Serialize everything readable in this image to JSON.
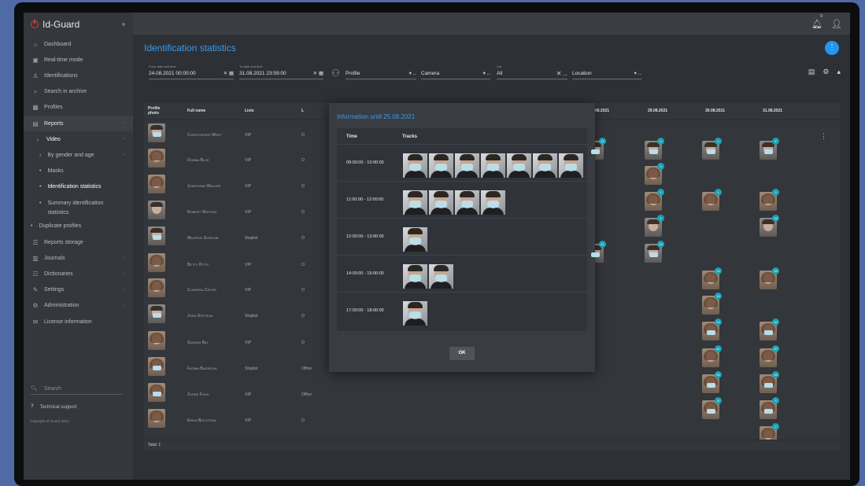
{
  "app": {
    "name": "Id-Guard"
  },
  "sidebar": {
    "items": [
      {
        "label": "Dashboard",
        "icon": "home-icon"
      },
      {
        "label": "Real-time mode",
        "icon": "realtime-icon"
      },
      {
        "label": "Identifications",
        "icon": "person-icon"
      },
      {
        "label": "Search in archive",
        "icon": "search-archive-icon"
      },
      {
        "label": "Profiles",
        "icon": "profiles-icon"
      },
      {
        "label": "Reports",
        "icon": "reports-icon"
      },
      {
        "label": "Video"
      },
      {
        "label": "By gender and age"
      },
      {
        "label": "Masks"
      },
      {
        "label": "Identification statistics"
      },
      {
        "label": "Summary identification statistics"
      },
      {
        "label": "Duplicate profiles"
      },
      {
        "label": "Reports storage",
        "icon": "storage-icon"
      },
      {
        "label": "Journals",
        "icon": "journals-icon"
      },
      {
        "label": "Dictionaries",
        "icon": "dictionaries-icon"
      },
      {
        "label": "Settings",
        "icon": "wrench-icon"
      },
      {
        "label": "Administration",
        "icon": "gear-icon"
      },
      {
        "label": "License information",
        "icon": "license-icon"
      }
    ],
    "search_placeholder": "Search",
    "support": "Technical support",
    "copyright": "Copyright Id-Guard 2021"
  },
  "topbar": {
    "notification_count": "0"
  },
  "page": {
    "title": "Identification statistics"
  },
  "filters": {
    "from": {
      "label": "From date and time",
      "value": "24.08.2021 00:00:00"
    },
    "to": {
      "label": "To date and time",
      "value": "31.08.2021 23:59:00"
    },
    "profile": "Profile",
    "camera": "Camera",
    "list": {
      "label": "List",
      "value": "All"
    },
    "location": "Location"
  },
  "table": {
    "columns": [
      "Profile photo",
      "Full name",
      "Lists",
      "L",
      "28.08.2021",
      "29.08.2021",
      "30.08.2021",
      "31.08.2021"
    ],
    "rows": [
      {
        "name": "Christopher West",
        "list": "VIP",
        "loc": "O"
      },
      {
        "name": "Donna Blue",
        "list": "VIP",
        "loc": "O"
      },
      {
        "name": "Josephine Walker",
        "list": "VIP",
        "loc": "O"
      },
      {
        "name": "Robert Watson",
        "list": "VIP",
        "loc": "O"
      },
      {
        "name": "Maurice Gordon",
        "list": "Stoplist",
        "loc": "O"
      },
      {
        "name": "Betty Pitts",
        "list": "VIP",
        "loc": "O"
      },
      {
        "name": "Clarissa Cross",
        "list": "VIP",
        "loc": "O"
      },
      {
        "name": "John Stetson",
        "list": "Stoplist",
        "loc": "O"
      },
      {
        "name": "Sandra Bay",
        "list": "VIP",
        "loc": "O"
      },
      {
        "name": "Fatima Bagirova",
        "list": "Stoplist",
        "loc": "Office"
      },
      {
        "name": "Zuhre Fosh",
        "list": "VIP",
        "loc": "Office"
      },
      {
        "name": "Erika Bolotova",
        "list": "VIP",
        "loc": "O"
      }
    ],
    "badges": {
      "c28": [
        "11",
        "",
        "",
        "",
        "21"
      ],
      "c29": [
        "4",
        "1",
        "1",
        "1",
        "22"
      ],
      "c30": [
        "1",
        "1",
        "13",
        "14",
        "12",
        "42",
        "32",
        "8"
      ],
      "c31": [
        "4",
        "9",
        "34",
        "33",
        "10",
        "37",
        "34",
        "3",
        "2"
      ]
    },
    "total": "Total: 1"
  },
  "modal": {
    "title": "Information until 25.08.2021",
    "head_time": "Time",
    "head_tracks": "Tracks",
    "rows": [
      {
        "time": "09:00:00 - 10:00:00",
        "tracks": 7
      },
      {
        "time": "11:00:00 - 12:00:00",
        "tracks": 4
      },
      {
        "time": "12:00:00 - 13:00:00",
        "tracks": 1
      },
      {
        "time": "14:00:00 - 15:00:00",
        "tracks": 2
      },
      {
        "time": "17:00:00 - 18:00:00",
        "tracks": 1
      }
    ],
    "ok": "OK"
  }
}
